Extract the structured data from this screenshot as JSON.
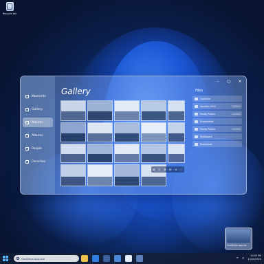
{
  "desktop": {
    "icon_label": "Recycle bin"
  },
  "gallery_window": {
    "title": "Gallery",
    "nav": [
      {
        "label": "Moments",
        "icon": "moments-icon",
        "active": false
      },
      {
        "label": "Gallery",
        "icon": "gallery-icon",
        "active": false
      },
      {
        "label": "Albums",
        "icon": "albums-icon",
        "active": true
      },
      {
        "label": "Albums",
        "icon": "albums-icon",
        "active": false
      },
      {
        "label": "People",
        "icon": "people-icon",
        "active": false
      },
      {
        "label": "Favorites",
        "icon": "favorites-icon",
        "active": false
      }
    ],
    "photo_toolbar": [
      "⊠",
      "⊡",
      "⊞",
      "⊟",
      "⋖",
      "⋮"
    ],
    "files": {
      "title": "Files",
      "items": [
        {
          "name": "OneDrive",
          "date": ""
        },
        {
          "name": "Vacation 2022",
          "date": "12/2022"
        },
        {
          "name": "Family Photos",
          "date": "12/2022"
        },
        {
          "name": "Screenshots",
          "date": ""
        },
        {
          "name": "Family Photos",
          "date": "12/2022"
        },
        {
          "name": "Wallpapers",
          "date": ""
        },
        {
          "name": "Downloads",
          "date": ""
        }
      ]
    }
  },
  "notification_thumb": {
    "label": "OneDrive.app.ex"
  },
  "taskbar": {
    "search_text": "OneDrive.app.exe",
    "time": "10:05 PM",
    "date": "12/20/2023"
  },
  "colors": {
    "accent": "#1d55c9",
    "window_glass": "#8fb0eb"
  }
}
